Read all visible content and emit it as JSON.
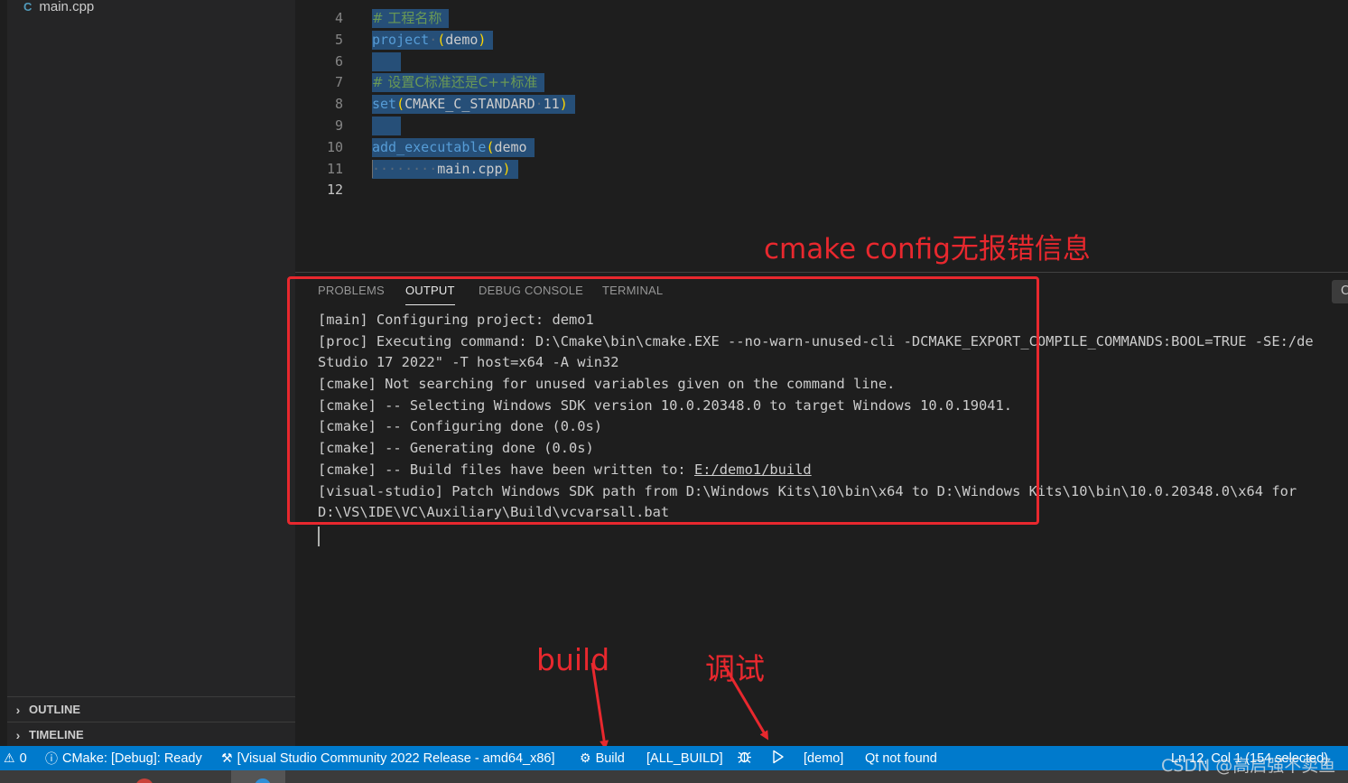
{
  "sidebar": {
    "file": {
      "icon": "cpp-file-icon",
      "icon_glyph": "C",
      "name": "main.cpp"
    },
    "outline_label": "OUTLINE",
    "timeline_label": "TIMELINE"
  },
  "editor": {
    "lines": [
      {
        "num": "4",
        "tokens": [
          {
            "t": "# 工程名称",
            "c": "cm"
          }
        ]
      },
      {
        "num": "5",
        "tokens": [
          {
            "t": "project",
            "c": "fn"
          },
          {
            "t": "·",
            "c": "ws"
          },
          {
            "t": "(",
            "c": "br"
          },
          {
            "t": "demo",
            "c": "tx"
          },
          {
            "t": ")",
            "c": "br"
          }
        ]
      },
      {
        "num": "6",
        "tokens": []
      },
      {
        "num": "7",
        "tokens": [
          {
            "t": "# 设置C标准还是C++标准",
            "c": "cm"
          }
        ]
      },
      {
        "num": "8",
        "tokens": [
          {
            "t": "set",
            "c": "fn"
          },
          {
            "t": "(",
            "c": "br"
          },
          {
            "t": "CMAKE_C_STANDARD",
            "c": "tx"
          },
          {
            "t": "·",
            "c": "ws"
          },
          {
            "t": "11",
            "c": "tx"
          },
          {
            "t": ")",
            "c": "br"
          }
        ]
      },
      {
        "num": "9",
        "tokens": []
      },
      {
        "num": "10",
        "tokens": [
          {
            "t": "add_executable",
            "c": "fn"
          },
          {
            "t": "(",
            "c": "br"
          },
          {
            "t": "demo",
            "c": "tx"
          }
        ]
      },
      {
        "num": "11",
        "tokens": [
          {
            "t": "········",
            "c": "ws"
          },
          {
            "t": "main.cpp",
            "c": "tx"
          },
          {
            "t": ")",
            "c": "br"
          }
        ]
      },
      {
        "num": "12",
        "tokens": [],
        "active": true
      }
    ]
  },
  "panel": {
    "tabs": [
      {
        "label": "PROBLEMS",
        "active": false
      },
      {
        "label": "OUTPUT",
        "active": true
      },
      {
        "label": "DEBUG CONSOLE",
        "active": false
      },
      {
        "label": "TERMINAL",
        "active": false
      }
    ],
    "output_lines": [
      "[main] Configuring project: demo1",
      "[proc] Executing command: D:\\Cmake\\bin\\cmake.EXE --no-warn-unused-cli -DCMAKE_EXPORT_COMPILE_COMMANDS:BOOL=TRUE -SE:/de",
      "Studio 17 2022\" -T host=x64 -A win32",
      "[cmake] Not searching for unused variables given on the command line.",
      "[cmake] -- Selecting Windows SDK version 10.0.20348.0 to target Windows 10.0.19041.",
      "[cmake] -- Configuring done (0.0s)",
      "[cmake] -- Generating done (0.0s)",
      "[cmake] -- Build files have been written to: |E:/demo1/build",
      "[visual-studio] Patch Windows SDK path from D:\\Windows Kits\\10\\bin\\x64 to D:\\Windows Kits\\10\\bin\\10.0.20348.0\\x64 for",
      "D:\\VS\\IDE\\VC\\Auxiliary\\Build\\vcvarsall.bat"
    ]
  },
  "annotations": {
    "config_note": "cmake config无报错信息",
    "build_note": "build",
    "debug_note": "调试",
    "color": "#e8282e"
  },
  "statusbar": {
    "warnings": "0",
    "cmake_status": "CMake: [Debug]: Ready",
    "kit": "[Visual Studio Community 2022 Release - amd64_x86]",
    "build": "Build",
    "target": "[ALL_BUILD]",
    "launch_target": "[demo]",
    "qt": "Qt not found",
    "cursor_pos": "Ln 12, Col 1 (154 selected)",
    "bg_color": "#007acc"
  },
  "watermark": "CSDN @高启强不卖鱼"
}
